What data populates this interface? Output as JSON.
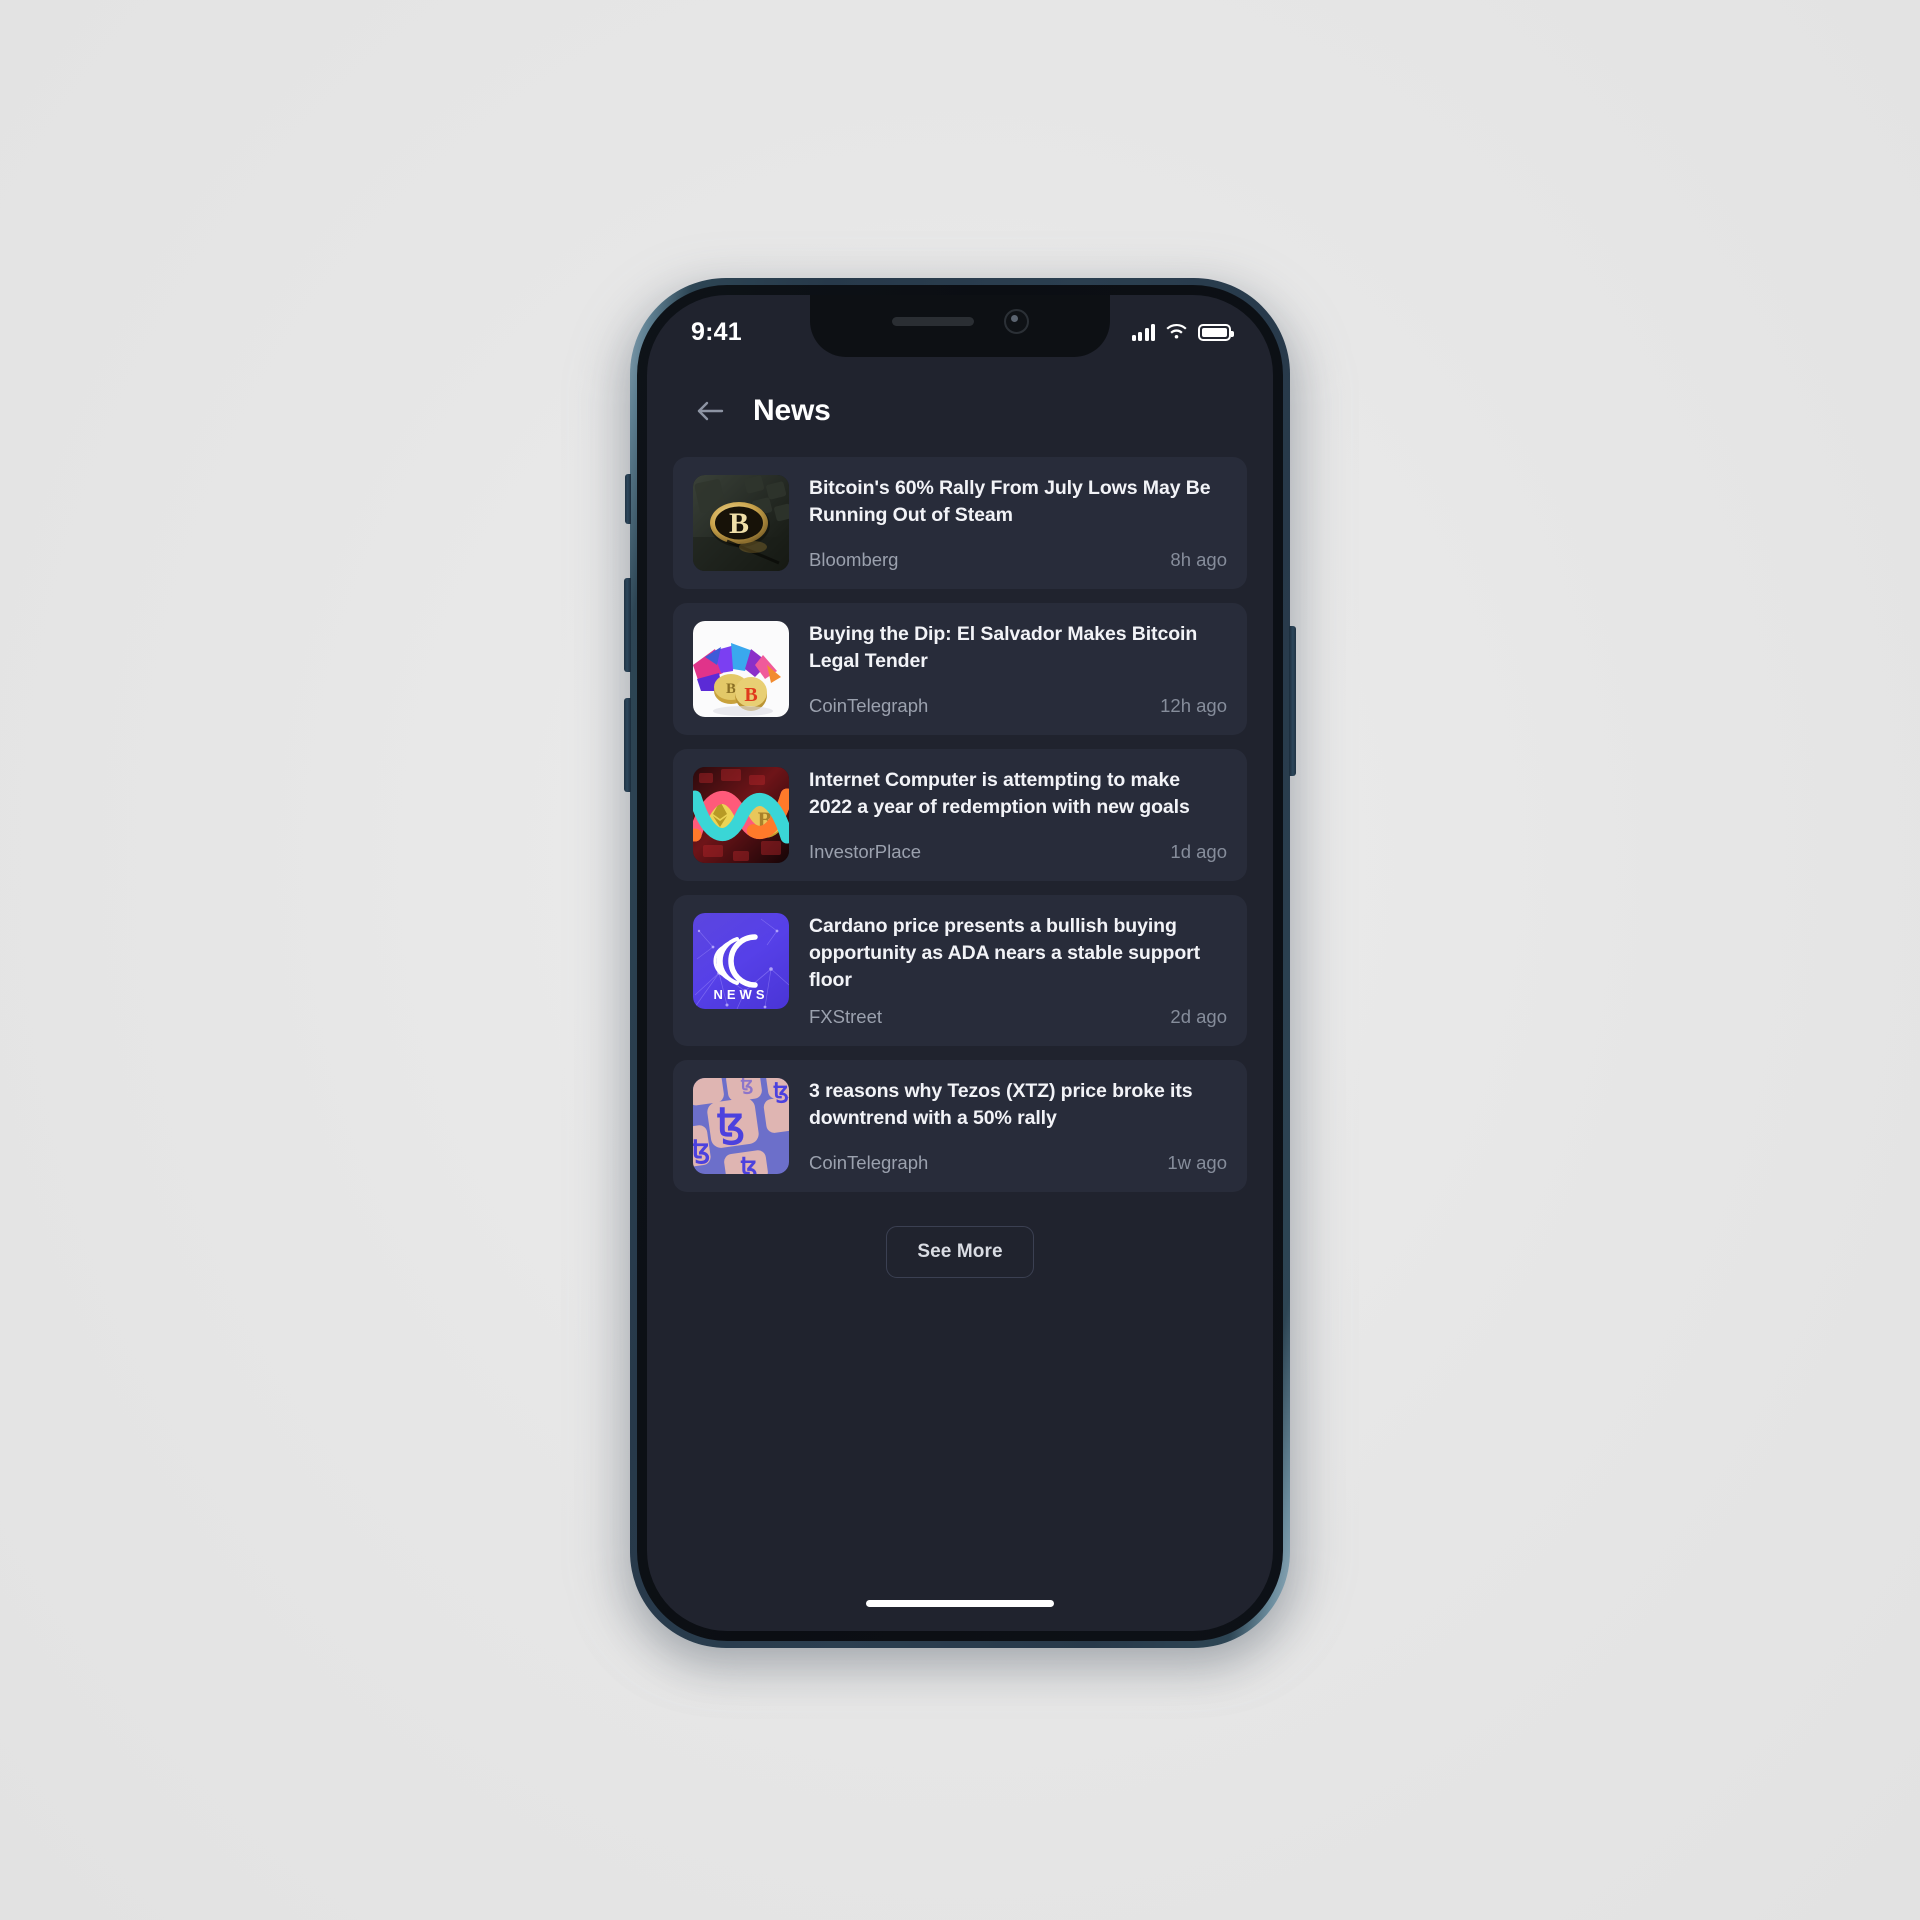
{
  "status_bar": {
    "time": "9:41",
    "signal_icon": "cellular-signal-icon",
    "wifi_icon": "wifi-icon",
    "battery_icon": "battery-full-icon"
  },
  "header": {
    "back_icon": "arrow-left-icon",
    "title": "News"
  },
  "news": {
    "items": [
      {
        "title": "Bitcoin's 60% Rally From July Lows May Be Running Out of Steam",
        "source": "Bloomberg",
        "time": "8h ago",
        "thumbnail": "bitcoin-coin-on-keyboard-photo"
      },
      {
        "title": "Buying the Dip: El Salvador Makes Bitcoin Legal Tender",
        "source": "CoinTelegraph",
        "time": "12h ago",
        "thumbnail": "bitcoin-coins-colorful-geometry-photo"
      },
      {
        "title": "Internet Computer is attempting to make 2022 a year of redemption with new goals",
        "source": "InvestorPlace",
        "time": "1d ago",
        "thumbnail": "internet-computer-infinity-logo-photo"
      },
      {
        "title": "Cardano price presents a bullish buying opportunity as ADA nears a stable support floor",
        "source": "FXStreet",
        "time": "2d ago",
        "thumbnail": "cardano-news-logo-image",
        "thumbnail_label": "NEWS"
      },
      {
        "title": "3 reasons why Tezos (XTZ) price broke its downtrend with a 50% rally",
        "source": "CoinTelegraph",
        "time": "1w ago",
        "thumbnail": "tezos-keyboard-keys-photo"
      }
    ]
  },
  "footer": {
    "see_more_label": "See More"
  },
  "colors": {
    "screen_background": "#20232e",
    "card_background": "#282c3a",
    "title_text": "#f2f3f7",
    "meta_text": "#9ba1ae",
    "border": "#3b4052",
    "frame_rail": "#2b3f50"
  }
}
